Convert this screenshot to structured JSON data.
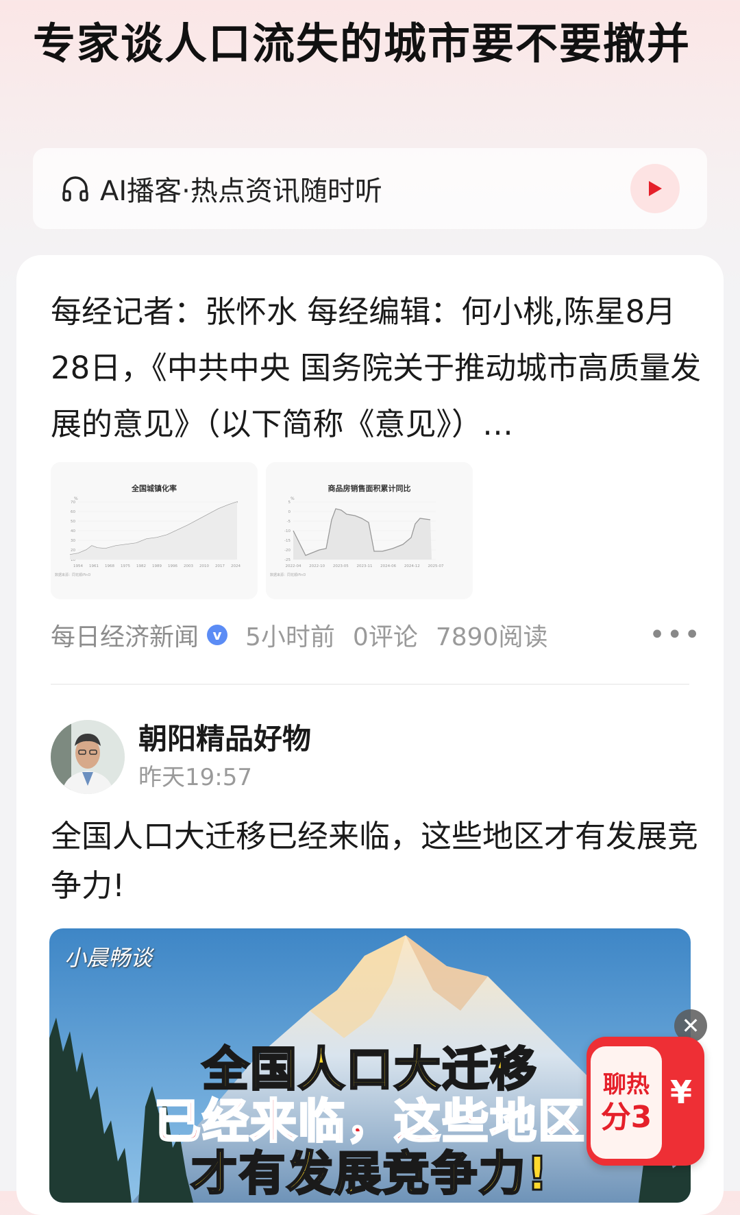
{
  "header": {
    "title": "专家谈人口流失的城市要不要撤并"
  },
  "podcast": {
    "label": "AI播客·热点资讯随时听",
    "icon": "headphones-icon",
    "play_icon": "play-icon",
    "accent": "#e5202a"
  },
  "article": {
    "summary": "每经记者：张怀水 每经编辑：何小桃,陈星8月28日，《中共中央 国务院关于推动城市高质量发展的意见》（以下简称《意见》）…",
    "thumbnails": [
      {
        "title": "全国城镇化率",
        "y_ticks": [
          "70",
          "60",
          "50",
          "40",
          "30",
          "20",
          "10"
        ],
        "x_ticks": [
          "1954",
          "1961",
          "1968",
          "1975",
          "1982",
          "1989",
          "1996",
          "2003",
          "2010",
          "2017",
          "2024"
        ],
        "unit": "%",
        "source": "数据来源：同花顺iFinD"
      },
      {
        "title": "商品房销售面积累计同比",
        "y_ticks": [
          "5",
          "0",
          "-5",
          "-10",
          "-15",
          "-20",
          "-25"
        ],
        "x_ticks": [
          "2022-04",
          "2022-10",
          "2023-05",
          "2023-11",
          "2024-06",
          "2024-12",
          "2025-07"
        ],
        "unit": "%",
        "source": "数据来源：同花顺iFinD"
      }
    ],
    "source": "每日经济新闻",
    "verified_mark": "v",
    "time": "5小时前",
    "comments": "0评论",
    "reads": "7890阅读"
  },
  "post": {
    "author": "朝阳精品好物",
    "time": "昨天19:57",
    "text": "全国人口大迁移已经来临，这些地区才有发展竞争力!",
    "video": {
      "watermark": "小晨畅谈",
      "line1": "全国人口大迁移",
      "line2": "已经来临，这些地区",
      "line3": "才有发展竞争力!"
    }
  },
  "floating": {
    "close_icon": "✕",
    "reward_line1": "聊热",
    "reward_line2": "分3",
    "reward_currency": "¥"
  }
}
